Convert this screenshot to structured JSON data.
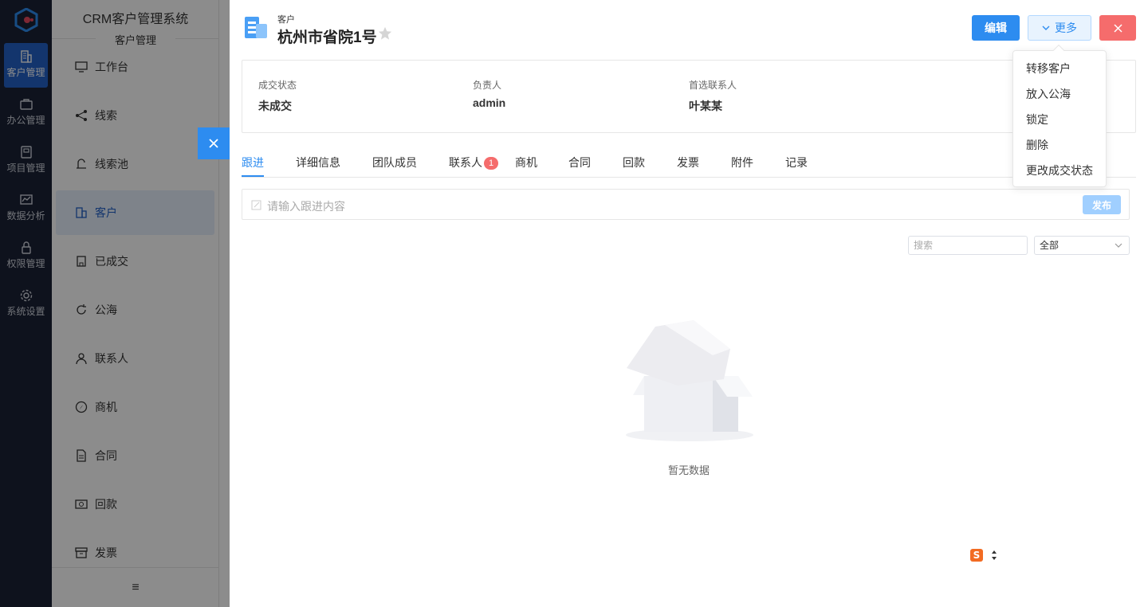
{
  "rail": {
    "items": [
      {
        "label": "客户管理",
        "icon": "building-icon",
        "active": true
      },
      {
        "label": "办公管理",
        "icon": "briefcase-icon"
      },
      {
        "label": "项目管理",
        "icon": "book-icon"
      },
      {
        "label": "数据分析",
        "icon": "chart-icon"
      },
      {
        "label": "权限管理",
        "icon": "lock-icon"
      },
      {
        "label": "系统设置",
        "icon": "gear-icon"
      }
    ]
  },
  "menu": {
    "title": "CRM客户管理系统",
    "subtitle": "客户管理",
    "items": [
      {
        "label": "工作台",
        "icon": "monitor-icon"
      },
      {
        "label": "线索",
        "icon": "share-icon"
      },
      {
        "label": "线索池",
        "icon": "pool-icon"
      },
      {
        "label": "客户",
        "icon": "building-icon",
        "active": true
      },
      {
        "label": "已成交",
        "icon": "office-icon"
      },
      {
        "label": "公海",
        "icon": "refresh-icon"
      },
      {
        "label": "联系人",
        "icon": "person-icon"
      },
      {
        "label": "商机",
        "icon": "compass-icon"
      },
      {
        "label": "合同",
        "icon": "document-icon"
      },
      {
        "label": "回款",
        "icon": "money-icon"
      },
      {
        "label": "发票",
        "icon": "archive-icon"
      }
    ],
    "collapse_icon": "≡"
  },
  "drawer": {
    "type_label": "客户",
    "title": "杭州市省院1号",
    "edit_label": "编辑",
    "more_label": "更多",
    "close_label": "×",
    "info": [
      {
        "label": "成交状态",
        "value": "未成交"
      },
      {
        "label": "负责人",
        "value": "admin"
      },
      {
        "label": "首选联系人",
        "value": "叶某某"
      }
    ],
    "tabs": [
      {
        "label": "跟进",
        "active": true
      },
      {
        "label": "详细信息"
      },
      {
        "label": "团队成员"
      },
      {
        "label": "联系人",
        "badge": "1"
      },
      {
        "label": "商机"
      },
      {
        "label": "合同"
      },
      {
        "label": "回款"
      },
      {
        "label": "发票"
      },
      {
        "label": "附件"
      },
      {
        "label": "记录"
      }
    ],
    "followup_placeholder": "请输入跟进内容",
    "publish_label": "发布",
    "search_placeholder": "搜索",
    "filter_value": "全部",
    "empty_text": "暂无数据"
  },
  "dropdown": {
    "items": [
      "转移客户",
      "放入公海",
      "锁定",
      "删除",
      "更改成交状态"
    ]
  },
  "colors": {
    "primary": "#2d8cf0",
    "danger": "#f56c6c",
    "rail_bg": "#1b2236"
  }
}
